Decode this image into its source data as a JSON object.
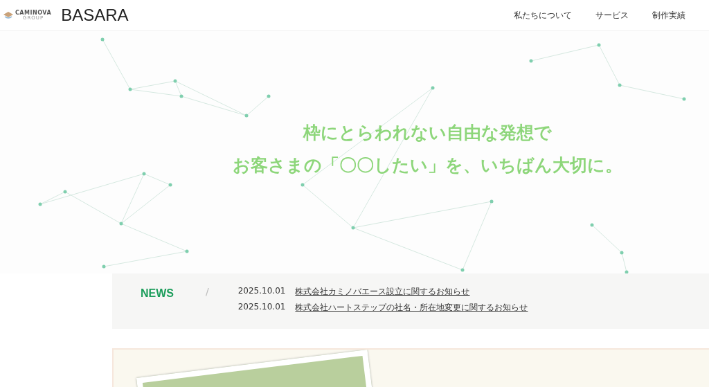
{
  "header": {
    "group_logo": "CAMINOVA",
    "group_sub": "GROUP",
    "site_name": "BASARA",
    "nav": [
      "私たちについて",
      "サービス",
      "制作実績"
    ]
  },
  "hero": {
    "lines": [
      "枠にとらわれない自由な発想で",
      "お客さまの「〇〇したい」を、いちばん大切に。"
    ]
  },
  "news": {
    "label": "NEWS",
    "separator": "/",
    "items": [
      {
        "date": "2025.10.01",
        "title": "株式会社カミノバエース設立に関するお知らせ"
      },
      {
        "date": "2025.10.01",
        "title": "株式会社ハートステップの社名・所在地変更に関するお知らせ"
      }
    ]
  }
}
